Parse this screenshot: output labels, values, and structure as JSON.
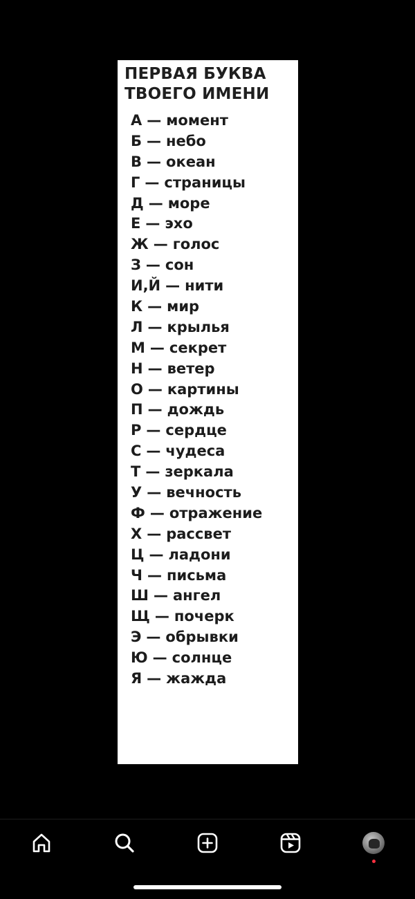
{
  "post": {
    "title_lines": [
      "ПЕРВАЯ БУКВА",
      "ТВОЕГО ИМЕНИ"
    ],
    "items": [
      {
        "letter": "А",
        "word": "момент"
      },
      {
        "letter": "Б",
        "word": "небо"
      },
      {
        "letter": "В",
        "word": "океан"
      },
      {
        "letter": "Г",
        "word": "страницы"
      },
      {
        "letter": "Д",
        "word": "море"
      },
      {
        "letter": "Е",
        "word": "эхо"
      },
      {
        "letter": "Ж",
        "word": "голос"
      },
      {
        "letter": "З",
        "word": "сон"
      },
      {
        "letter": "И,Й",
        "word": "нити"
      },
      {
        "letter": "К",
        "word": "мир"
      },
      {
        "letter": "Л",
        "word": "крылья"
      },
      {
        "letter": "М",
        "word": "секрет"
      },
      {
        "letter": "Н",
        "word": "ветер"
      },
      {
        "letter": "О",
        "word": "картины"
      },
      {
        "letter": "П",
        "word": "дождь"
      },
      {
        "letter": "Р",
        "word": "сердце"
      },
      {
        "letter": "С",
        "word": "чудеса"
      },
      {
        "letter": "Т",
        "word": "зеркала"
      },
      {
        "letter": "У",
        "word": "вечность"
      },
      {
        "letter": "Ф",
        "word": "отражение"
      },
      {
        "letter": "Х",
        "word": "рассвет"
      },
      {
        "letter": "Ц",
        "word": "ладони"
      },
      {
        "letter": "Ч",
        "word": "письма"
      },
      {
        "letter": "Ш",
        "word": "ангел"
      },
      {
        "letter": "Щ",
        "word": "почерк"
      },
      {
        "letter": "Э",
        "word": "обрывки"
      },
      {
        "letter": "Ю",
        "word": "солнце"
      },
      {
        "letter": "Я",
        "word": "жажда"
      }
    ],
    "separator": "—"
  },
  "tabbar": {
    "tabs": [
      {
        "name": "home",
        "icon": "home-icon"
      },
      {
        "name": "search",
        "icon": "search-icon"
      },
      {
        "name": "create",
        "icon": "plus-square-icon"
      },
      {
        "name": "reels",
        "icon": "reels-icon"
      },
      {
        "name": "profile",
        "icon": "avatar"
      }
    ],
    "has_notification_dot": true
  },
  "colors": {
    "background": "#000000",
    "card": "#ffffff",
    "text": "#1c1c1c",
    "icons": "#ffffff",
    "notification": "#ff3040"
  }
}
